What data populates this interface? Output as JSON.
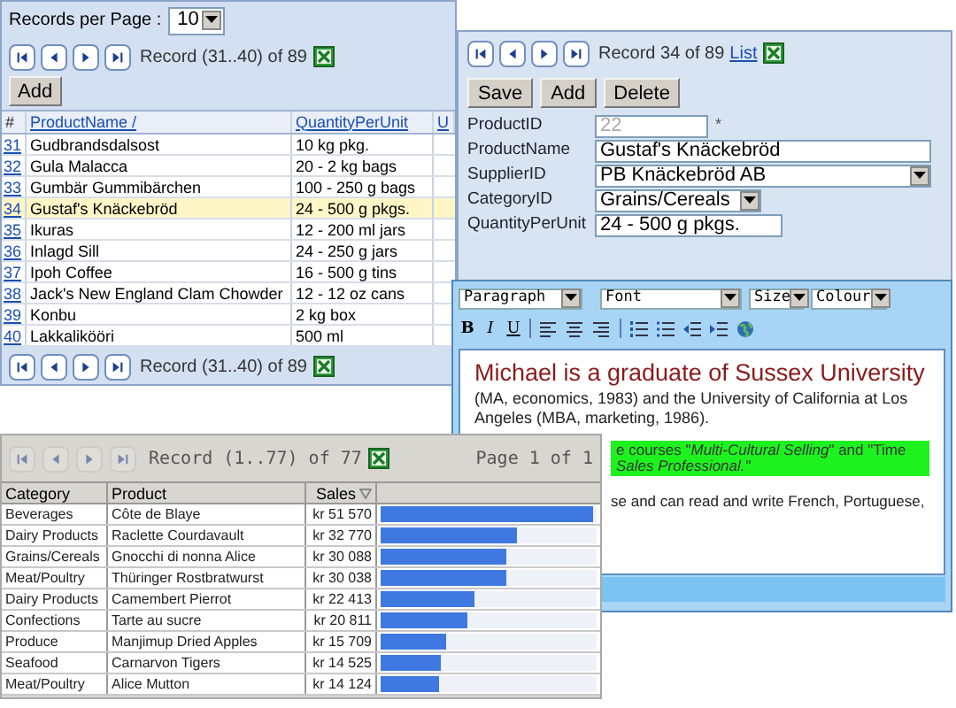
{
  "records_window": {
    "page_size_label": "Records per Page :",
    "page_size": "10",
    "pager_top": "Record (31..40) of 89",
    "add_button": "Add",
    "columns": [
      {
        "label": "#",
        "link": false
      },
      {
        "label": "ProductName /",
        "link": true
      },
      {
        "label": "QuantityPerUnit",
        "link": true
      },
      {
        "label": "U",
        "link": true
      }
    ],
    "rows": [
      {
        "number": "31",
        "name": "Gudbrandsdalsost",
        "quantity": "10 kg pkg.",
        "selected": false
      },
      {
        "number": "32",
        "name": "Gula Malacca",
        "quantity": "20 - 2 kg bags",
        "selected": false
      },
      {
        "number": "33",
        "name": "Gumbär Gummibärchen",
        "quantity": "100 - 250 g bags",
        "selected": false
      },
      {
        "number": "34",
        "name": "Gustaf's Knäckebröd",
        "quantity": "24 - 500 g pkgs.",
        "selected": true
      },
      {
        "number": "35",
        "name": "Ikuras",
        "quantity": "12 - 200 ml jars",
        "selected": false
      },
      {
        "number": "36",
        "name": "Inlagd Sill",
        "quantity": "24 - 250 g jars",
        "selected": false
      },
      {
        "number": "37",
        "name": "Ipoh Coffee",
        "quantity": "16 - 500 g tins",
        "selected": false
      },
      {
        "number": "38",
        "name": "Jack's New England Clam Chowder",
        "quantity": "12 - 12 oz cans",
        "selected": false
      },
      {
        "number": "39",
        "name": "Konbu",
        "quantity": "2 kg box",
        "selected": false
      },
      {
        "number": "40",
        "name": "Lakkalikööri",
        "quantity": "500 ml",
        "selected": false
      }
    ],
    "pager_bottom": "Record (31..40) of 89"
  },
  "detail_window": {
    "record_text": "Record 34 of 89",
    "list_link": "List",
    "buttons": [
      "Save",
      "Add",
      "Delete"
    ],
    "fields": [
      {
        "label": "ProductID",
        "kind": "readonly",
        "value": "22",
        "required_mark": "*"
      },
      {
        "label": "ProductName",
        "kind": "text-wide",
        "value": "Gustaf's Knäckebröd"
      },
      {
        "label": "SupplierID",
        "kind": "select-wide",
        "value": "PB Knäckebröd AB"
      },
      {
        "label": "CategoryID",
        "kind": "select",
        "value": "Grains/Cereals"
      },
      {
        "label": "QuantityPerUnit",
        "kind": "text",
        "value": "24 - 500 g pkgs."
      }
    ]
  },
  "editor": {
    "block_format": "Paragraph",
    "font": "Font",
    "size": "Size",
    "colour": "Colour",
    "format_buttons": [
      "B",
      "I",
      "U"
    ],
    "lead": "Michael is a graduate of Sussex University",
    "lead_rest": " (MA, economics, 1983) and the University of California at Los Angeles (MBA, marketing, 1986).",
    "highlight_lines": [
      "e courses \"*Multi-Cultural Selling*\" and \"Time",
      "*Sales Professional.\"*"
    ],
    "trailing_text": "se and can read and write French, Portuguese,"
  },
  "sales_grid": {
    "record_text": "Record (1..77) of 77",
    "page_text": "Page 1 of 1",
    "columns": [
      "Category",
      "Product",
      "Sales"
    ],
    "rows": [
      {
        "category": "Beverages",
        "product": "Côte de Blaye",
        "sales": "kr 51 570",
        "level": 0.98
      },
      {
        "category": "Dairy Products",
        "product": "Raclette Courdavault",
        "sales": "kr 32 770",
        "level": 0.635
      },
      {
        "category": "Grains/Cereals",
        "product": "Gnocchi di nonna Alice",
        "sales": "kr 30 088",
        "level": 0.583
      },
      {
        "category": "Meat/Poultry",
        "product": "Thüringer Rostbratwurst",
        "sales": "kr 30 038",
        "level": 0.582
      },
      {
        "category": "Dairy Products",
        "product": "Camembert Pierrot",
        "sales": "kr 22 413",
        "level": 0.435
      },
      {
        "category": "Confections",
        "product": "Tarte au sucre",
        "sales": "kr 20 811",
        "level": 0.404
      },
      {
        "category": "Produce",
        "product": "Manjimup Dried Apples",
        "sales": "kr 15 709",
        "level": 0.305
      },
      {
        "category": "Seafood",
        "product": "Carnarvon Tigers",
        "sales": "kr 14 525",
        "level": 0.282
      },
      {
        "category": "Meat/Poultry",
        "product": "Alice Mutton",
        "sales": "kr 14 124",
        "level": 0.274
      }
    ]
  }
}
